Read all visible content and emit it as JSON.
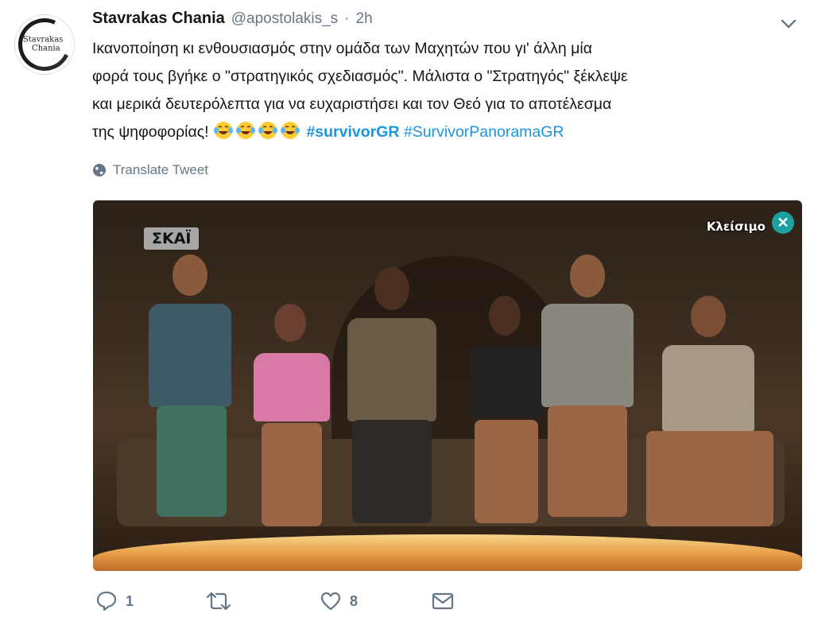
{
  "tweet": {
    "author_name": "Stavrakas Chania",
    "handle": "@apostolakis_s",
    "separator": "·",
    "time": "2h",
    "avatar_text_1": "Stavrakas",
    "avatar_text_2": "Chania",
    "text_lines": [
      "Ικανοποίηση κι ενθουσιασμός στην ομάδα των Μαχητών που γι' άλλη μία",
      "φορά τους βγήκε ο \"στρατηγικός σχεδιασμός\". Μάλιστα ο \"Στρατηγός\" ξέκλεψε",
      "και μερικά δευτερόλεπτα για να ευχαριστήσει και τον Θεό για το αποτέλεσμα",
      "της ψηφοφορίας!"
    ],
    "emoji": [
      "laughing-tears",
      "laughing-tears",
      "laughing-tears",
      "laughing-tears"
    ],
    "hashtags": [
      "#survivorGR",
      "#SurvivorPanoramaGR"
    ],
    "translate_label": "Translate Tweet"
  },
  "media": {
    "channel_logo": "ΣΚΑΪ",
    "close_label": "Κλείσιμο",
    "close_symbol": "✕"
  },
  "actions": {
    "reply_count": "1",
    "retweet_count": "",
    "like_count": "8"
  },
  "colors": {
    "link": "#1b95e0",
    "muted": "#657786",
    "text": "#14171a"
  },
  "icons": [
    "globe-icon",
    "chevron-down-icon",
    "reply-icon",
    "retweet-icon",
    "like-icon",
    "message-icon",
    "close-icon"
  ]
}
